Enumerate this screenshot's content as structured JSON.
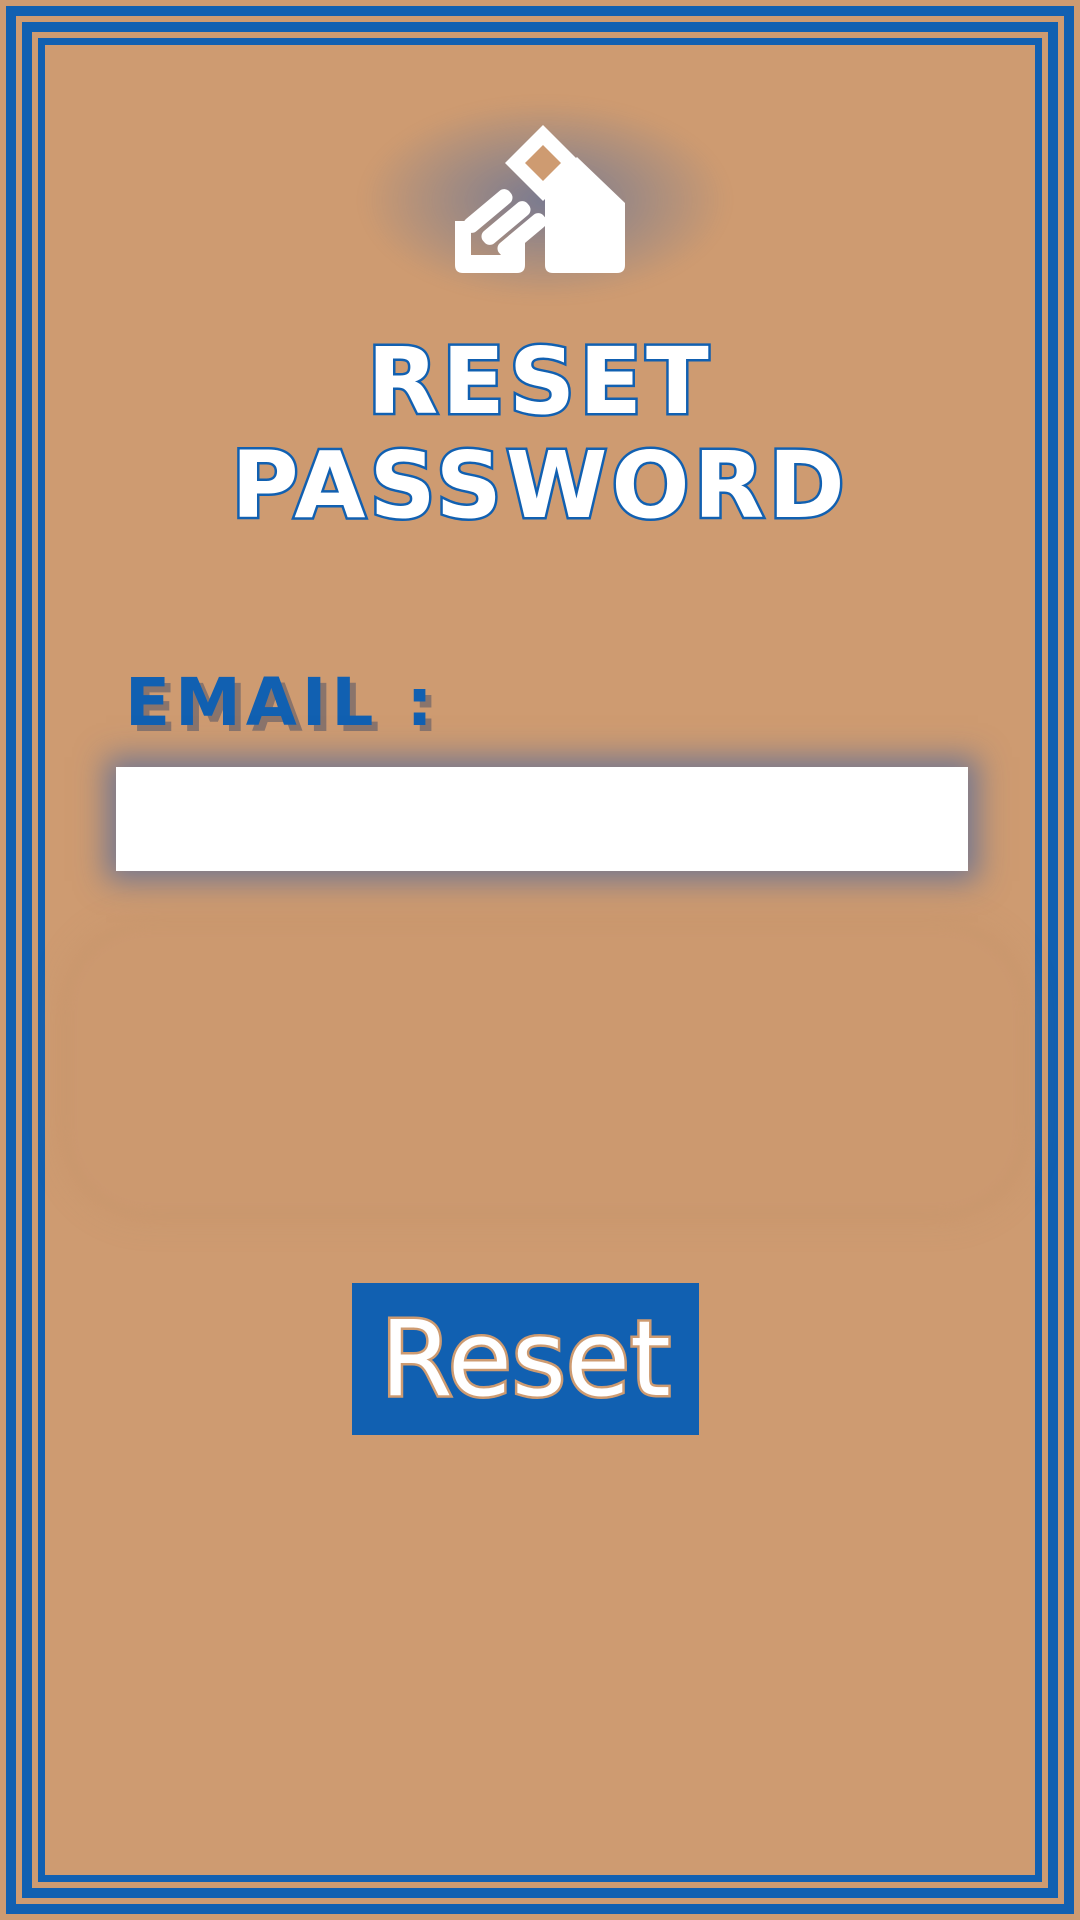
{
  "screen": {
    "title": "RESET PASSWORD",
    "email_label": "EMAIL :",
    "email_value": "",
    "email_placeholder": "",
    "button_label": "Reset"
  },
  "icons": {
    "logo": "house-with-key-logo-icon"
  },
  "colors": {
    "background": "#CE9B71",
    "accent": "#1160B1",
    "input_bg": "#FFFFFF",
    "title_fill": "#FFFFFF"
  }
}
